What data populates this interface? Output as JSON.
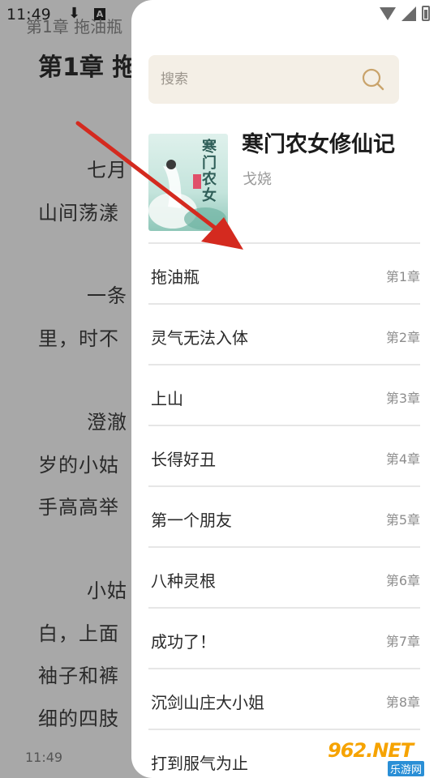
{
  "status_bar": {
    "time": "11:49",
    "download_icon": "download-icon",
    "a_badge": "A"
  },
  "reader": {
    "running_title": "第1章 拖油瓶",
    "chapter_heading": "第1章 拖",
    "lines": [
      "七月",
      "山间荡漾",
      "一条",
      "里，时不",
      "澄澈",
      "岁的小姑",
      "手高高举",
      "小姑",
      "白，上面",
      "袖子和裤",
      "细的四肢"
    ],
    "bottom_time": "11:49"
  },
  "drawer": {
    "search": {
      "placeholder": "搜索"
    },
    "book": {
      "title": "寒门农女修仙记",
      "author": "戈娆",
      "cover_text": "寒门农女"
    },
    "chapters": [
      {
        "name": "拖油瓶",
        "num": "第1章"
      },
      {
        "name": "灵气无法入体",
        "num": "第2章"
      },
      {
        "name": "上山",
        "num": "第3章"
      },
      {
        "name": "长得好丑",
        "num": "第4章"
      },
      {
        "name": "第一个朋友",
        "num": "第5章"
      },
      {
        "name": "八种灵根",
        "num": "第6章"
      },
      {
        "name": "成功了！",
        "num": "第7章"
      },
      {
        "name": "沉剑山庄大小姐",
        "num": "第8章"
      },
      {
        "name": "打到服气为止",
        "num": ""
      }
    ]
  },
  "watermark": {
    "text": "962.NET",
    "sub": "乐游网"
  },
  "colors": {
    "accent_search": "#c9a36b",
    "arrow": "#d42a1f",
    "drawer_bg": "#ffffff",
    "search_bg": "#f4efe6"
  }
}
